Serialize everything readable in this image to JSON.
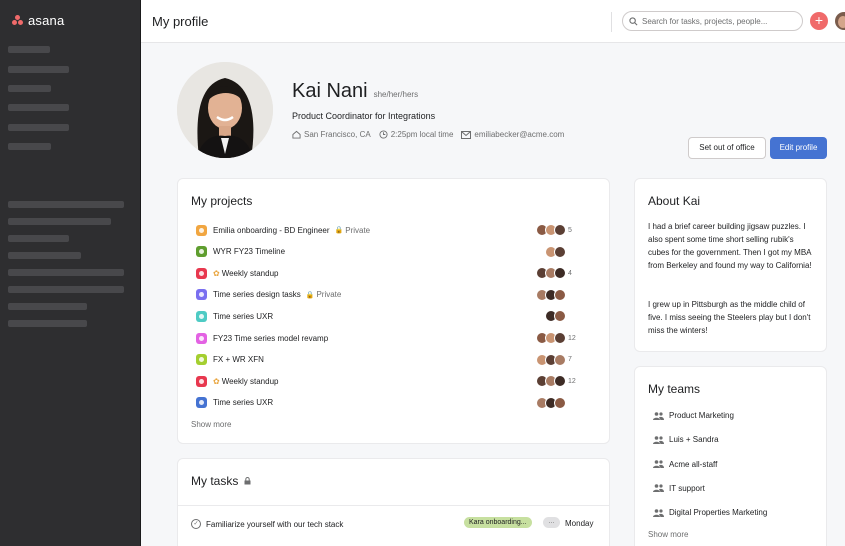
{
  "app": {
    "logo_text": "asana",
    "brand_color": "#f06a6a",
    "accent": "#4573d2"
  },
  "header": {
    "title": "My profile",
    "search_placeholder": "Search for tasks, projects, people...",
    "add_icon": "plus-icon"
  },
  "profile": {
    "name": "Kai Nani",
    "pronouns": "she/her/hers",
    "job_title": "Product Coordinator for Integrations",
    "location": "San Francisco, CA",
    "local_time": "2:25pm local time",
    "email": "emiliabecker@acme.com",
    "buttons": {
      "out_of_office": "Set out of office",
      "edit": "Edit profile"
    }
  },
  "projects": {
    "title": "My projects",
    "items": [
      {
        "name": "Emilia onboarding - BD Engineer",
        "private": "Private",
        "color": "#f1a641",
        "count": "5",
        "faces": 3,
        "emoji": ""
      },
      {
        "name": "WYR FY23 Timeline",
        "private": "",
        "color": "#5f9e2f",
        "count": "",
        "faces": 2,
        "emoji": ""
      },
      {
        "name": "Weekly standup",
        "private": "",
        "color": "#e8384f",
        "count": "4",
        "faces": 3,
        "emoji": "✿"
      },
      {
        "name": "Time series design tasks",
        "private": "Private",
        "color": "#7a6ff0",
        "count": "",
        "faces": 3,
        "emoji": ""
      },
      {
        "name": "Time series UXR",
        "private": "",
        "color": "#4ecbc4",
        "count": "",
        "faces": 2,
        "emoji": ""
      },
      {
        "name": "FY23 Time series model revamp",
        "private": "",
        "color": "#e362e3",
        "count": "12",
        "faces": 3,
        "emoji": ""
      },
      {
        "name": "FX + WR XFN",
        "private": "",
        "color": "#a4cf30",
        "count": "7",
        "faces": 3,
        "emoji": ""
      },
      {
        "name": "Weekly standup",
        "private": "",
        "color": "#e8384f",
        "count": "12",
        "faces": 3,
        "emoji": "✿"
      },
      {
        "name": "Time series UXR",
        "private": "",
        "color": "#4573d2",
        "count": "",
        "faces": 3,
        "emoji": ""
      }
    ],
    "show_more": "Show more"
  },
  "tasks": {
    "title": "My tasks",
    "items": [
      {
        "name": "Familiarize yourself with our tech stack",
        "tag": "Kara onboarding...",
        "more": "...",
        "due": "Monday"
      }
    ]
  },
  "about": {
    "title": "About Kai",
    "paragraphs": [
      "I had a brief career building jigsaw puzzles. I also spent some time short selling rubik's cubes for the government. Then I got my MBA from Berkeley and found my way to California!",
      "I grew up in Pittsburgh as the middle child of five. I miss seeing the Steelers play but I don't miss the winters!"
    ]
  },
  "teams": {
    "title": "My teams",
    "items": [
      "Product Marketing",
      "Luis + Sandra",
      "Acme all-staff",
      "IT support",
      "Digital Properties Marketing"
    ],
    "show_more": "Show more"
  }
}
